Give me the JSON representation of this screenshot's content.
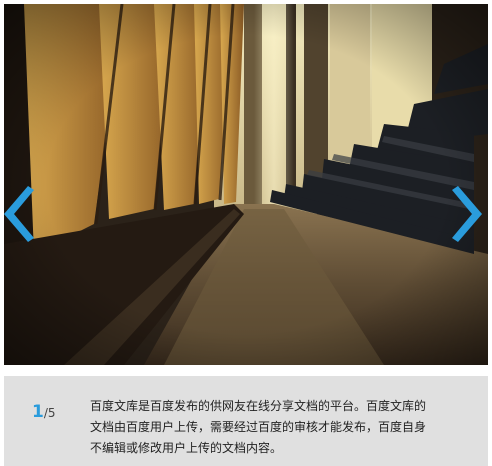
{
  "slide": {
    "image_description_icon": "lecture-hall-photo",
    "current_index": "1",
    "separator": "/",
    "total": "5",
    "caption_lines": [
      "百度文库是百度发布的供网友在线分享文档的平台。百度文库的",
      "文档由百度用户上传，需要经过百度的审核才能发布，百度自身",
      "不编辑或修改用户上传的文档内容。"
    ]
  },
  "colors": {
    "arrow": "#2a9cdc",
    "caption_bg": "#e0e0e0",
    "counter_accent": "#2a9cdc"
  },
  "controls": {
    "prev_icon": "chevron-left-icon",
    "next_icon": "chevron-right-icon"
  }
}
